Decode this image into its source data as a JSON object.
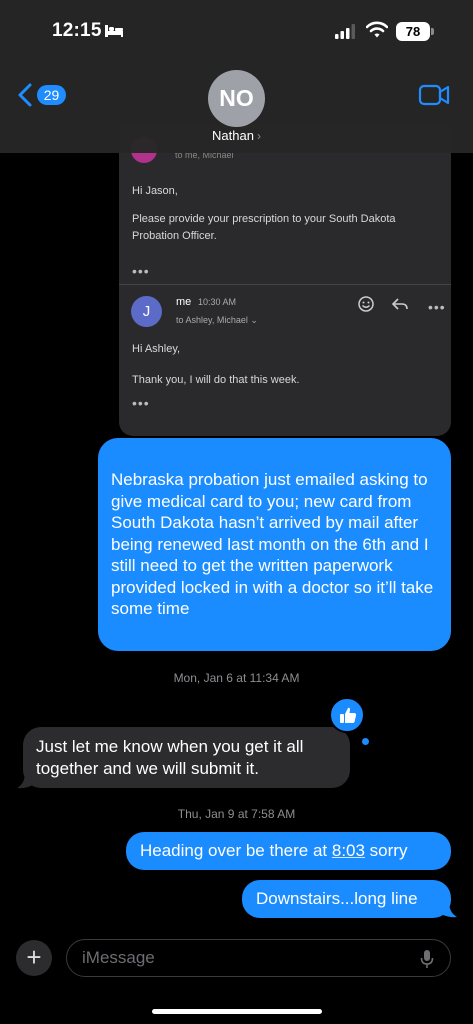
{
  "status_bar": {
    "time": "12:15",
    "battery": "78"
  },
  "header": {
    "back_count": "29",
    "avatar_initials": "NO",
    "contact_name": "Nathan",
    "chevron": "›"
  },
  "email_image": {
    "to_line": "to me, Michael",
    "greeting1": "Hi Jason,",
    "body1_line1": "Please provide your prescription to your South Dakota",
    "body1_line2": "Probation Officer.",
    "ellipsis": "•••",
    "sender_initial": "J",
    "sender": "me",
    "time": "10:30 AM",
    "to_line2": "to Ashley, Michael ⌄",
    "greeting2": "Hi Ashley,",
    "body2": "Thank you, I will do that this week."
  },
  "messages": {
    "m1": "Nebraska probation just emailed asking to give medical card to you; new card from South Dakota hasn’t arrived by mail after being renewed last month on the 6th and I still need to get the written paperwork provided locked in with a doctor so it’ll take some time",
    "ts1_day": "Mon, Jan 6",
    "ts1_time": "at 11:34 AM",
    "m2": "Just let me know when you get it all together and we will submit it.",
    "ts2_day": "Thu, Jan 9",
    "ts2_time": "at 7:58 AM",
    "m3_before": "Heading over be there at ",
    "m3_link": "8:03",
    "m3_after": " sorry",
    "m4": "Downstairs...long line"
  },
  "compose": {
    "placeholder": "iMessage",
    "plus": "+"
  },
  "colors": {
    "outgoing": "#1a8cff",
    "incoming": "#2c2c2e",
    "accent": "#1f8cff"
  },
  "icons": [
    "bed-icon",
    "signal-icon",
    "wifi-icon",
    "back-chevron-icon",
    "video-camera-icon",
    "thumbs-up-icon",
    "mic-icon",
    "plus-icon"
  ]
}
